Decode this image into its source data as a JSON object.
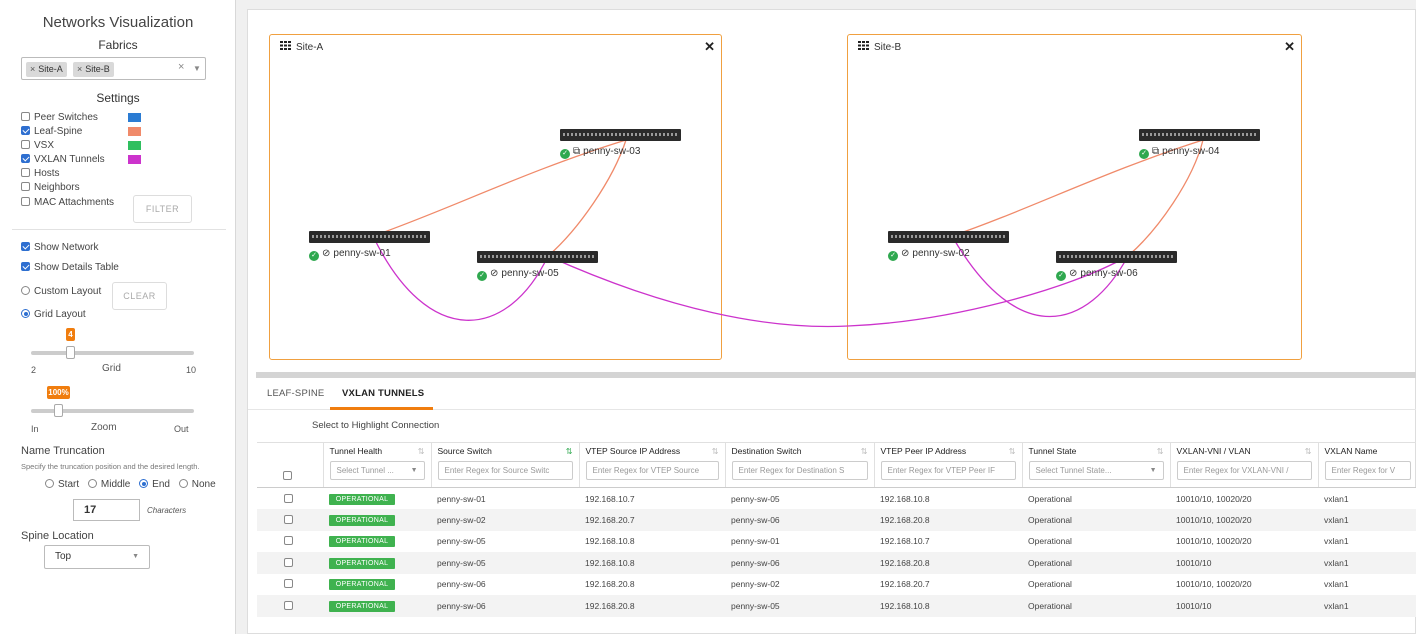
{
  "left_panel": {
    "title": "Networks Visualization",
    "fabrics_label": "Fabrics",
    "fabric_tags": [
      "Site-A",
      "Site-B"
    ],
    "settings_label": "Settings",
    "settings": [
      {
        "label": "Peer Switches",
        "checked": false,
        "color": "#2b7cd3"
      },
      {
        "label": "Leaf-Spine",
        "checked": true,
        "color": "#f08a6a"
      },
      {
        "label": "VSX",
        "checked": false,
        "color": "#2fbf5f"
      },
      {
        "label": "VXLAN Tunnels",
        "checked": true,
        "color": "#cc33cc"
      },
      {
        "label": "Hosts",
        "checked": false
      },
      {
        "label": "Neighbors",
        "checked": false
      },
      {
        "label": "MAC Attachments",
        "checked": false
      }
    ],
    "filter_button": "FILTER",
    "show_network": "Show Network",
    "show_details_table": "Show Details Table",
    "custom_layout": "Custom Layout",
    "clear_button": "CLEAR",
    "grid_layout": "Grid Layout",
    "grid_slider": {
      "value": "4",
      "min": "2",
      "label": "Grid",
      "max": "10"
    },
    "zoom_slider": {
      "value": "100%",
      "min": "In",
      "label": "Zoom",
      "max": "Out"
    },
    "name_truncation": "Name Truncation",
    "truncation_desc": "Specify the truncation position and the desired length.",
    "truncation_options": [
      "Start",
      "Middle",
      "End",
      "None"
    ],
    "truncation_selected": "End",
    "characters_value": "17",
    "characters_label": "Characters",
    "spine_location": "Spine Location",
    "spine_value": "Top"
  },
  "network": {
    "sites": [
      "Site-A",
      "Site-B"
    ],
    "nodes": {
      "sw01": "penny-sw-01",
      "sw02": "penny-sw-02",
      "sw03": "penny-sw-03",
      "sw04": "penny-sw-04",
      "sw05": "penny-sw-05",
      "sw06": "penny-sw-06"
    },
    "colors": {
      "leaf_spine": "#f08a6a",
      "vxlan": "#cc33cc",
      "site_border": "#f0a040",
      "ok": "#2fa84f"
    }
  },
  "tabs": [
    "LEAF-SPINE",
    "VXLAN TUNNELS"
  ],
  "active_tab": "VXLAN TUNNELS",
  "hint": "Select to Highlight Connection",
  "table": {
    "columns": [
      "Tunnel Health",
      "Source Switch",
      "VTEP Source IP Address",
      "Destination Switch",
      "VTEP Peer IP Address",
      "Tunnel State",
      "VXLAN-VNI / VLAN",
      "VXLAN Name"
    ],
    "filters": [
      "Select Tunnel ...",
      "Enter Regex for Source Switc",
      "Enter Regex for VTEP Source",
      "Enter Regex for Destination S",
      "Enter Regex for VTEP Peer IF",
      "Select Tunnel State...",
      "Enter Regex for VXLAN-VNI /",
      "Enter Regex for V"
    ],
    "rows": [
      [
        "OPERATIONAL",
        "penny-sw-01",
        "192.168.10.7",
        "penny-sw-05",
        "192.168.10.8",
        "Operational",
        "10010/10, 10020/20",
        "vxlan1"
      ],
      [
        "OPERATIONAL",
        "penny-sw-02",
        "192.168.20.7",
        "penny-sw-06",
        "192.168.20.8",
        "Operational",
        "10010/10, 10020/20",
        "vxlan1"
      ],
      [
        "OPERATIONAL",
        "penny-sw-05",
        "192.168.10.8",
        "penny-sw-01",
        "192.168.10.7",
        "Operational",
        "10010/10, 10020/20",
        "vxlan1"
      ],
      [
        "OPERATIONAL",
        "penny-sw-05",
        "192.168.10.8",
        "penny-sw-06",
        "192.168.20.8",
        "Operational",
        "10010/10",
        "vxlan1"
      ],
      [
        "OPERATIONAL",
        "penny-sw-06",
        "192.168.20.8",
        "penny-sw-02",
        "192.168.20.7",
        "Operational",
        "10010/10, 10020/20",
        "vxlan1"
      ],
      [
        "OPERATIONAL",
        "penny-sw-06",
        "192.168.20.8",
        "penny-sw-05",
        "192.168.10.8",
        "Operational",
        "10010/10",
        "vxlan1"
      ]
    ]
  }
}
